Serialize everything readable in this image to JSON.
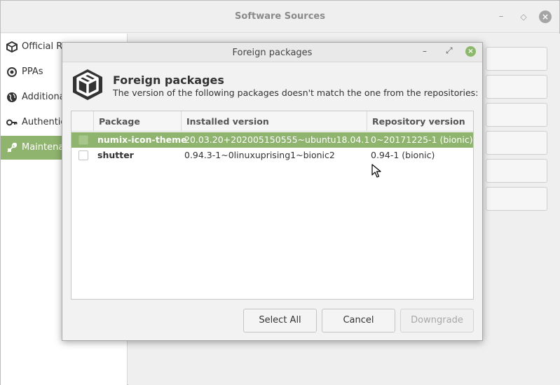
{
  "main_window": {
    "title": "Software Sources",
    "sidebar": [
      {
        "label": "Official Repositories",
        "icon": "package-icon"
      },
      {
        "label": "PPAs",
        "icon": "ppa-icon"
      },
      {
        "label": "Additional repositories",
        "icon": "globe-icon"
      },
      {
        "label": "Authentication Keys",
        "icon": "key-icon"
      },
      {
        "label": "Maintenance",
        "icon": "tools-icon",
        "active": true
      }
    ]
  },
  "dialog": {
    "title": "Foreign packages",
    "heading": "Foreign packages",
    "description": "The version of the following packages doesn't match the one from the repositories:",
    "columns": [
      "",
      "Package",
      "Installed version",
      "Repository version"
    ],
    "rows": [
      {
        "package": "numix-icon-theme",
        "installed": "20.03.20+202005150555~ubuntu18.04.1",
        "repository": "0~20171225-1 (bionic)",
        "selected": true
      },
      {
        "package": "shutter",
        "installed": "0.94.3-1~0linuxuprising1~bionic2",
        "repository": "0.94-1 (bionic)",
        "selected": false
      }
    ],
    "buttons": {
      "select_all": "Select All",
      "cancel": "Cancel",
      "downgrade": "Downgrade"
    }
  },
  "colors": {
    "accent": "#8fb46e",
    "close_button": "#8cb86b"
  }
}
